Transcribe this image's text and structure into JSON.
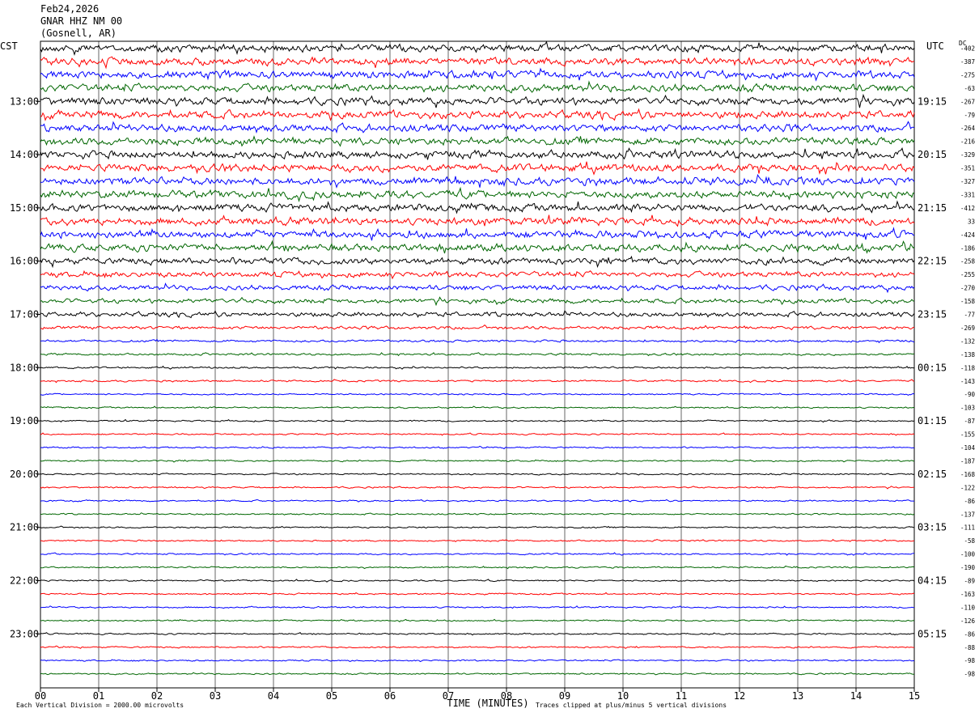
{
  "header": {
    "date": "Feb24,2026",
    "station": "GNAR HHZ NM 00",
    "location": "(Gosnell, AR)"
  },
  "left_zone": "CST",
  "right_zone": "UTC",
  "dc_label": "DC",
  "footer": {
    "scale_note": "Each Vertical Division = 2000.00 microvolts",
    "xlabel": "TIME (MINUTES)",
    "clip_note": "Traces clipped at plus/minus 5 vertical divisions"
  },
  "colors": {
    "trace_cycle": [
      "#000000",
      "#ff0000",
      "#0000ff",
      "#006600"
    ],
    "grid": "#000000",
    "background": "#ffffff"
  },
  "chart_data": {
    "type": "helicorder",
    "x_ticks": [
      "00",
      "01",
      "02",
      "03",
      "04",
      "05",
      "06",
      "07",
      "08",
      "09",
      "10",
      "11",
      "12",
      "13",
      "14",
      "15"
    ],
    "xlim": [
      0,
      15
    ],
    "xlabel": "TIME (MINUTES)",
    "traces_per_hour": 4,
    "trace_minutes": 15,
    "left_hour_labels": [
      "13:00",
      "14:00",
      "15:00",
      "16:00",
      "17:00",
      "18:00",
      "19:00",
      "20:00",
      "21:00",
      "22:00",
      "23:00"
    ],
    "right_hour_labels": [
      "19:15",
      "20:15",
      "21:15",
      "22:15",
      "23:15",
      "00:15",
      "01:15",
      "02:15",
      "03:15",
      "04:15",
      "05:15"
    ],
    "dc_offsets": [
      -402,
      -387,
      -275,
      -63,
      -267,
      -79,
      -264,
      -216,
      -329,
      -351,
      -327,
      -331,
      -412,
      33,
      -424,
      -186,
      -258,
      -255,
      -270,
      -158,
      -77,
      -269,
      -132,
      -138,
      -118,
      -143,
      -90,
      -103,
      -87,
      -155,
      -104,
      -187,
      -168,
      -122,
      -86,
      -137,
      -111,
      -58,
      -100,
      -190,
      -89,
      -163,
      -110,
      -126,
      -86,
      -88,
      -98,
      -98
    ],
    "trace_amplitude_level": [
      3,
      3,
      3,
      3,
      3,
      3,
      3,
      3,
      3,
      3,
      3,
      3,
      3,
      3,
      3,
      3,
      2.6,
      2.2,
      2,
      1.8,
      1.8,
      1.3,
      0.9,
      0.8,
      0.7,
      0.7,
      0.6,
      0.6,
      0.6,
      0.6,
      0.6,
      0.6,
      0.6,
      0.6,
      0.6,
      0.6,
      0.6,
      0.6,
      0.6,
      0.6,
      0.6,
      0.6,
      0.6,
      0.6,
      0.6,
      0.6,
      0.6,
      0.6
    ]
  }
}
